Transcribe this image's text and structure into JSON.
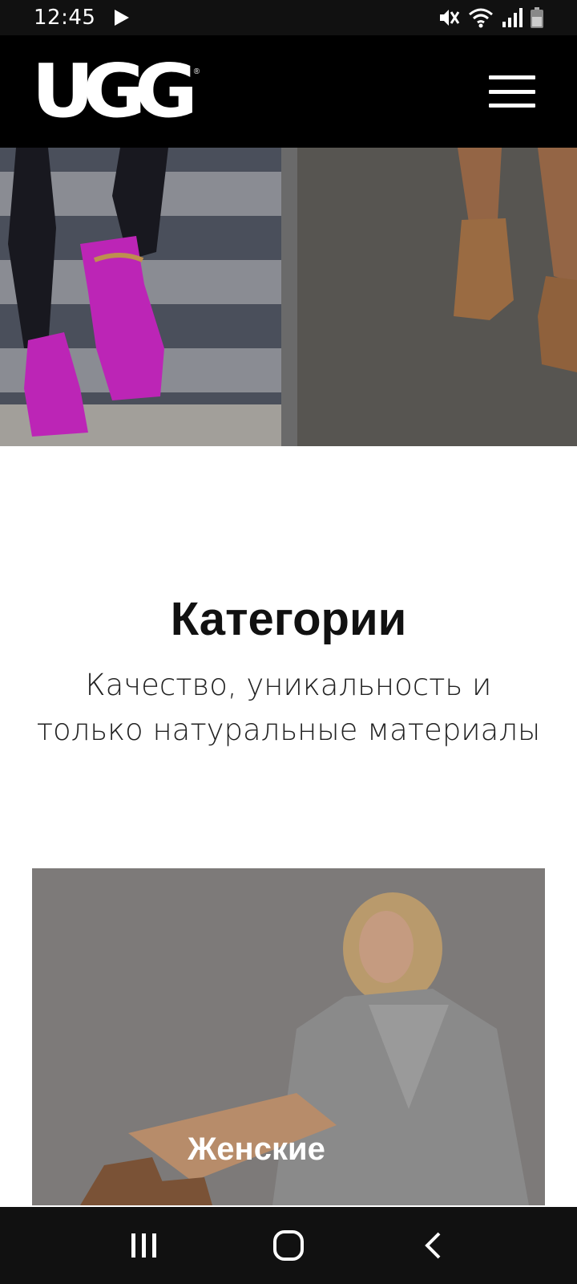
{
  "status_bar": {
    "time": "12:45",
    "icons": [
      "play-icon",
      "mute-icon",
      "wifi-icon",
      "signal-icon",
      "battery-icon"
    ]
  },
  "header": {
    "logo_text": "UGG",
    "logo_mark": "®",
    "menu_icon": "hamburger-menu-icon"
  },
  "categories": {
    "title": "Категории",
    "subtitle": "Качество, уникальность и только натуральные материалы",
    "items": [
      {
        "label": "Женские"
      }
    ]
  },
  "nav_bar": {
    "icons": [
      "recent-apps-icon",
      "home-icon",
      "back-icon"
    ]
  },
  "colors": {
    "header_bg": "#000000",
    "status_bg": "#111111",
    "text": "#111111",
    "accent_pink": "#d72bd0"
  }
}
